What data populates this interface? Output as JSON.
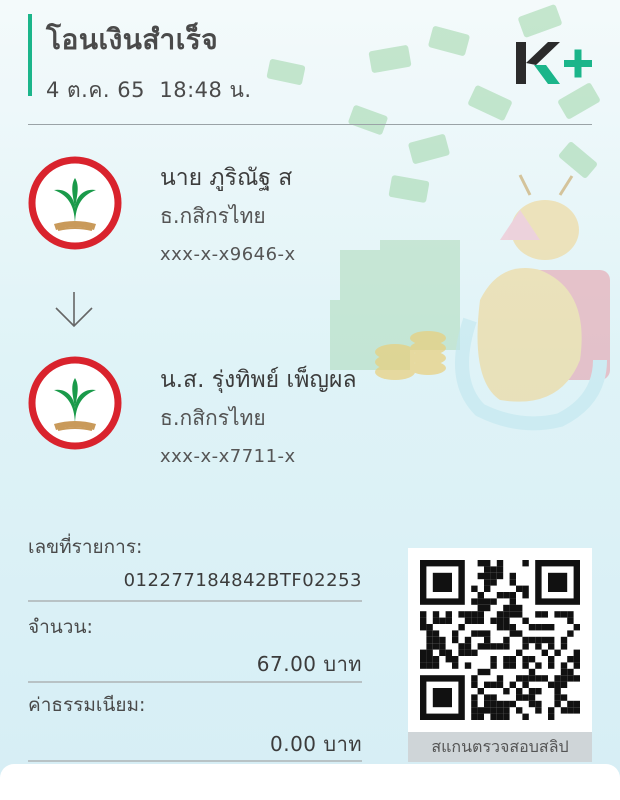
{
  "header": {
    "title": "โอนเงินสำเร็จ",
    "date": "4 ต.ค. 65",
    "time": "18:48 น.",
    "brand_logo": "K+",
    "brand_color": "#1bb58a"
  },
  "sender": {
    "name": "นาย ภูริณัฐ ส",
    "bank": "ธ.กสิกรไทย",
    "account": "xxx-x-x9646-x",
    "logo_icon": "kasikorn-bank-icon"
  },
  "transfer_arrow_icon": "arrow-down-icon",
  "receiver": {
    "name": "น.ส. รุ่งทิพย์ เพ็ญผล",
    "bank": "ธ.กสิกรไทย",
    "account": "xxx-x-x7711-x",
    "logo_icon": "kasikorn-bank-icon"
  },
  "details": {
    "ref_label": "เลขที่รายการ:",
    "ref_value": "012277184842BTF02253",
    "amount_label": "จำนวน:",
    "amount_value": "67.00 บาท",
    "fee_label": "ค่าธรรมเนียม:",
    "fee_value": "0.00 บาท"
  },
  "qr": {
    "icon": "qr-code-icon",
    "caption": "สแกนตรวจสอบสลิป"
  },
  "colors": {
    "bank_red": "#d9232d",
    "bank_green": "#1a9a4a",
    "accent_green": "#1bb58a"
  }
}
